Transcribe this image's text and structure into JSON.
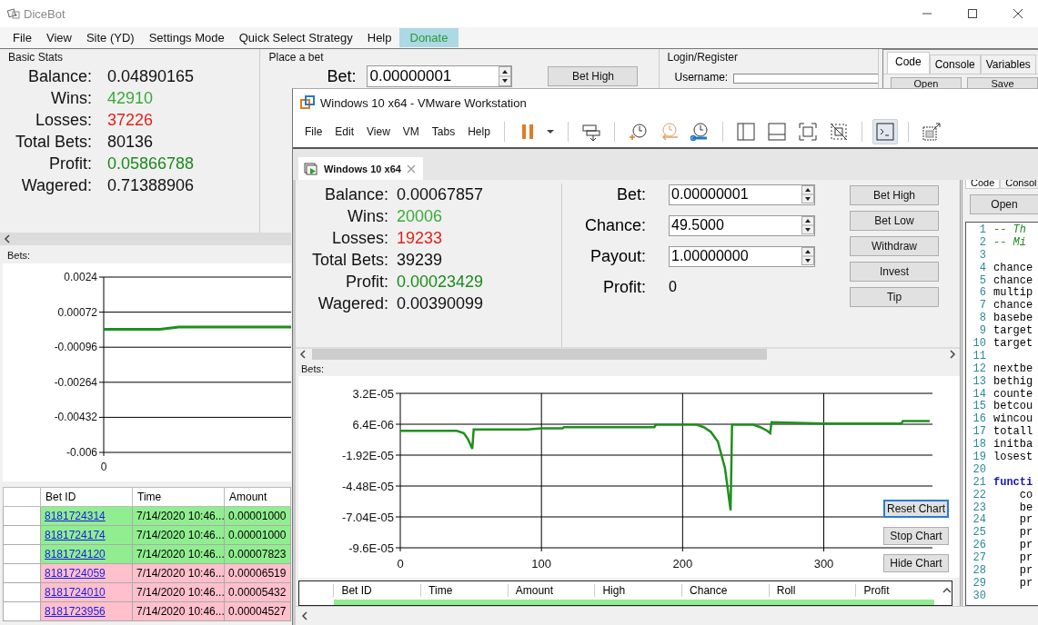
{
  "dicebot": {
    "title": "DiceBot",
    "menu": [
      {
        "label": "File",
        "selected": false
      },
      {
        "label": "View",
        "selected": false
      },
      {
        "label": "Site (YD)",
        "selected": false
      },
      {
        "label": "Settings Mode",
        "selected": false
      },
      {
        "label": "Quick Select Strategy",
        "selected": false
      },
      {
        "label": "Help",
        "selected": false
      },
      {
        "label": "Donate",
        "selected": true
      }
    ],
    "basic_stats": {
      "title": "Basic Stats",
      "rows": [
        {
          "label": "Balance:",
          "value": "0.04890165",
          "kind": "plain"
        },
        {
          "label": "Wins:",
          "value": "42910",
          "kind": "win"
        },
        {
          "label": "Losses:",
          "value": "37226",
          "kind": "loss"
        },
        {
          "label": "Total Bets:",
          "value": "80136",
          "kind": "plain"
        },
        {
          "label": "Profit:",
          "value": "0.05866788",
          "kind": "profit"
        },
        {
          "label": "Wagered:",
          "value": "0.71388906",
          "kind": "plain"
        }
      ]
    },
    "place_bet": {
      "title": "Place a bet",
      "bet_label": "Bet:",
      "bet_value": "0.00000001",
      "button": "Bet High"
    },
    "login": {
      "title": "Login/Register",
      "username_label": "Username:"
    },
    "side_tabs": [
      {
        "label": "Code",
        "selected": true
      },
      {
        "label": "Console",
        "selected": false
      },
      {
        "label": "Variables",
        "selected": false
      }
    ],
    "side_buttons": [
      "Open",
      "Save"
    ],
    "bets_label": "Bets:",
    "x_origin_label": "0",
    "chart_data": {
      "type": "line",
      "grid": true,
      "series": [
        {
          "color": "#1f8f1f",
          "values": [
            -0.0001,
            -0.0001,
            -0.0001,
            -0.0001,
            0,
            0,
            0,
            0,
            0,
            0,
            0
          ]
        }
      ],
      "ylim": [
        -0.006,
        0.0024
      ],
      "yticks": [
        {
          "value": 0.0024,
          "label": "0.0024"
        },
        {
          "value": 0.00072,
          "label": "0.00072"
        },
        {
          "value": -0.00096,
          "label": "-0.00096"
        },
        {
          "value": -0.00264,
          "label": "-0.00264"
        },
        {
          "value": -0.00432,
          "label": "-0.00432"
        },
        {
          "value": -0.006,
          "label": "-0.006"
        }
      ]
    },
    "table": {
      "columns": [
        "Bet ID",
        "Time",
        "Amount"
      ],
      "rows": [
        {
          "kind": "win",
          "bet_id": "8181724314",
          "time": "7/14/2020 10:46...",
          "amount": "0.00001000"
        },
        {
          "kind": "win",
          "bet_id": "8181724174",
          "time": "7/14/2020 10:46...",
          "amount": "0.00001000"
        },
        {
          "kind": "win",
          "bet_id": "8181724120",
          "time": "7/14/2020 10:46...",
          "amount": "0.00007823"
        },
        {
          "kind": "loss",
          "bet_id": "8181724059",
          "time": "7/14/2020 10:46...",
          "amount": "0.00006519"
        },
        {
          "kind": "loss",
          "bet_id": "8181724010",
          "time": "7/14/2020 10:46...",
          "amount": "0.00005432"
        },
        {
          "kind": "loss",
          "bet_id": "8181723956",
          "time": "7/14/2020 10:46...",
          "amount": "0.00004527"
        }
      ]
    }
  },
  "vmware": {
    "title": "Windows 10 x64 - VMware Workstation",
    "menu": [
      "File",
      "Edit",
      "View",
      "VM",
      "Tabs",
      "Help"
    ],
    "toolbar": [
      [
        {
          "kind": "pause",
          "selected": false
        },
        {
          "kind": "dropdown",
          "selected": false
        }
      ],
      [
        {
          "kind": "send-keys",
          "selected": false
        }
      ],
      [
        {
          "kind": "snapshot-take",
          "selected": false
        },
        {
          "kind": "snapshot-revert",
          "selected": false
        },
        {
          "kind": "snapshot-manage",
          "selected": false
        }
      ],
      [
        {
          "kind": "sidebar",
          "selected": false
        },
        {
          "kind": "bottom-panel",
          "selected": false
        },
        {
          "kind": "fullscreen",
          "selected": false
        },
        {
          "kind": "unity",
          "selected": false
        }
      ],
      [
        {
          "kind": "console",
          "selected": true
        }
      ],
      [
        {
          "kind": "stretch",
          "selected": false
        }
      ]
    ],
    "tab": {
      "label": "Windows 10 x64",
      "selected": true
    },
    "guest": {
      "stats": [
        {
          "label": "Balance:",
          "value": "0.00067857",
          "kind": "plain"
        },
        {
          "label": "Wins:",
          "value": "20006",
          "kind": "win"
        },
        {
          "label": "Losses:",
          "value": "19233",
          "kind": "loss"
        },
        {
          "label": "Total Bets:",
          "value": "39239",
          "kind": "plain"
        },
        {
          "label": "Profit:",
          "value": "0.00023429",
          "kind": "profit"
        },
        {
          "label": "Wagered:",
          "value": "0.00390099",
          "kind": "plain"
        }
      ],
      "bet_form": [
        {
          "label": "Bet:",
          "value": "0.00000001",
          "kind": "spin"
        },
        {
          "label": "Chance:",
          "value": "49.5000",
          "kind": "spin"
        },
        {
          "label": "Payout:",
          "value": "1.00000000",
          "kind": "spin"
        },
        {
          "label": "Profit:",
          "value": "0",
          "kind": "text"
        }
      ],
      "buttons": [
        "Bet High",
        "Bet Low",
        "Withdraw",
        "Invest",
        "Tip"
      ],
      "bets_label": "Bets:",
      "chart_data": {
        "type": "line",
        "grid": true,
        "x": [
          0,
          10,
          20,
          30,
          40,
          45,
          48,
          51,
          52,
          70,
          90,
          100,
          115,
          116,
          150,
          180,
          181,
          210,
          215,
          220,
          225,
          230,
          234,
          235,
          250,
          255,
          260,
          262,
          263,
          300,
          340,
          355,
          356,
          375
        ],
        "series": [
          {
            "color": "#1f8f1f",
            "values": [
              1e-06,
              1e-06,
              1e-06,
              1e-06,
              1e-06,
              -1e-06,
              -6e-06,
              -1.4e-05,
              2e-06,
              2e-06,
              2e-06,
              3e-06,
              3e-06,
              4e-06,
              4e-06,
              4e-06,
              6e-06,
              6e-06,
              4e-06,
              0,
              -8e-06,
              -3e-05,
              -6.5e-05,
              6e-06,
              6e-06,
              4e-06,
              1e-06,
              -1e-06,
              8e-06,
              7e-06,
              7e-06,
              7e-06,
              9e-06,
              9e-06
            ]
          }
        ],
        "xlim": [
          0,
          377
        ],
        "ylim": [
          -9.6e-05,
          3.2e-05
        ],
        "yticks": [
          {
            "value": 3.2e-05,
            "label": "3.2E-05"
          },
          {
            "value": 6.4e-06,
            "label": "6.4E-06"
          },
          {
            "value": -1.92e-05,
            "label": "-1.92E-05"
          },
          {
            "value": -4.48e-05,
            "label": "-4.48E-05"
          },
          {
            "value": -7.04e-05,
            "label": "-7.04E-05"
          },
          {
            "value": -9.6e-05,
            "label": "-9.6E-05"
          }
        ],
        "xticks": [
          0,
          100,
          200,
          300
        ]
      },
      "chart_buttons": [
        {
          "label": "Reset Chart",
          "focused": true
        },
        {
          "label": "Stop Chart",
          "focused": false
        },
        {
          "label": "Hide Chart",
          "focused": false
        }
      ],
      "table": {
        "columns": [
          "Bet ID",
          "Time",
          "Amount",
          "High",
          "Chance",
          "Roll",
          "Profit"
        ],
        "partial_row": {
          "kind": "win"
        }
      },
      "code_tabs": [
        {
          "label": "Code",
          "selected": true
        },
        {
          "label": "Consol",
          "selected": false
        }
      ],
      "code_button": "Open",
      "code_lines": [
        {
          "number": "1",
          "text": "-- Th",
          "kind": "comment"
        },
        {
          "number": "2",
          "text": "-- Mi",
          "kind": "comment"
        },
        {
          "number": "3"
        },
        {
          "number": "4",
          "text": "chance",
          "kind": "plain"
        },
        {
          "number": "5",
          "text": "chance",
          "kind": "plain"
        },
        {
          "number": "6",
          "text": "multip",
          "kind": "plain"
        },
        {
          "number": "7",
          "text": "chance",
          "kind": "plain"
        },
        {
          "number": "8",
          "text": "basebe",
          "kind": "plain"
        },
        {
          "number": "9",
          "text": "target",
          "kind": "plain"
        },
        {
          "number": "10",
          "text": "target",
          "kind": "plain"
        },
        {
          "number": "11"
        },
        {
          "number": "12",
          "text": "nextbe",
          "kind": "plain"
        },
        {
          "number": "13",
          "text": "bethig",
          "kind": "plain"
        },
        {
          "number": "14",
          "text": "counte",
          "kind": "plain"
        },
        {
          "number": "15",
          "text": "betcou",
          "kind": "plain"
        },
        {
          "number": "16",
          "text": "wincou",
          "kind": "plain"
        },
        {
          "number": "17",
          "text": "totall",
          "kind": "plain"
        },
        {
          "number": "18",
          "text": "initba",
          "kind": "plain"
        },
        {
          "number": "19",
          "text": "losest",
          "kind": "plain"
        },
        {
          "number": "20"
        },
        {
          "number": "21",
          "text": "functi",
          "kind": "keyword"
        },
        {
          "number": "22",
          "text": "    co",
          "kind": "plain"
        },
        {
          "number": "23",
          "text": "    be",
          "kind": "plain"
        },
        {
          "number": "24",
          "text": "    pr",
          "kind": "plain"
        },
        {
          "number": "25",
          "text": "    pr",
          "kind": "plain"
        },
        {
          "number": "26",
          "text": "    pr",
          "kind": "plain"
        },
        {
          "number": "27",
          "text": "    pr",
          "kind": "plain"
        },
        {
          "number": "28",
          "text": "    pr",
          "kind": "plain"
        },
        {
          "number": "29",
          "text": "    pr",
          "kind": "plain"
        },
        {
          "number": "30"
        }
      ]
    }
  }
}
